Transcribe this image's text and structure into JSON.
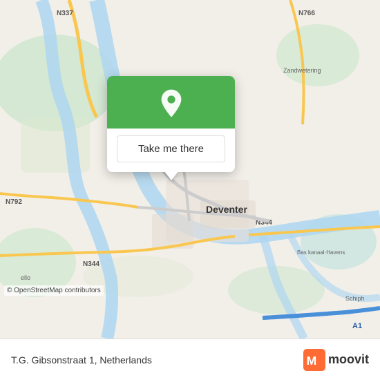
{
  "map": {
    "attribution": "© OpenStreetMap contributors",
    "center_city": "Deventer",
    "road_labels": [
      "N337",
      "N792",
      "N344",
      "N344",
      "N344",
      "N766",
      "A1"
    ],
    "bg_color": "#f2efe9"
  },
  "popup": {
    "button_label": "Take me there",
    "icon": "location-pin-icon"
  },
  "bottom_bar": {
    "address": "T.G. Gibsonstraat 1, Netherlands",
    "logo_text": "moovit"
  }
}
